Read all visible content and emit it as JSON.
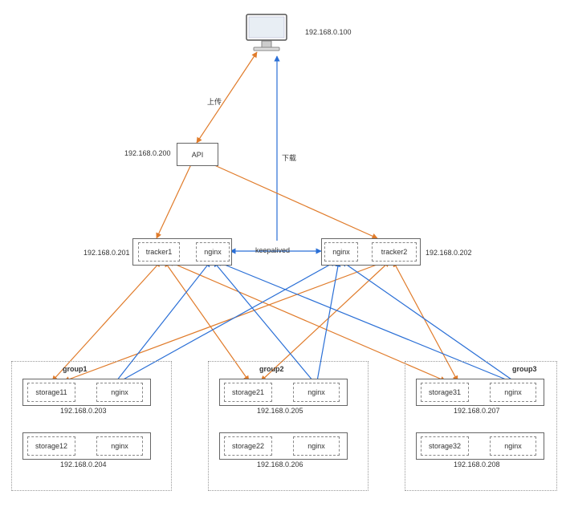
{
  "client": {
    "ip": "192.168.0.100"
  },
  "edges": {
    "upload": "上传",
    "download": "下载",
    "keepalived": "keepalived"
  },
  "api": {
    "label": "API",
    "ip": "192.168.0.200"
  },
  "tracker1": {
    "label": "tracker1",
    "nginx": "nginx",
    "ip": "192.168.0.201"
  },
  "tracker2": {
    "label": "tracker2",
    "nginx": "nginx",
    "ip": "192.168.0.202"
  },
  "group1": {
    "title": "group1",
    "a": {
      "storage": "storage11",
      "nginx": "nginx",
      "ip": "192.168.0.203"
    },
    "b": {
      "storage": "storage12",
      "nginx": "nginx",
      "ip": "192.168.0.204"
    }
  },
  "group2": {
    "title": "group2",
    "a": {
      "storage": "storage21",
      "nginx": "nginx",
      "ip": "192.168.0.205"
    },
    "b": {
      "storage": "storage22",
      "nginx": "nginx",
      "ip": "192.168.0.206"
    }
  },
  "group3": {
    "title": "group3",
    "a": {
      "storage": "storage31",
      "nginx": "nginx",
      "ip": "192.168.0.207"
    },
    "b": {
      "storage": "storage32",
      "nginx": "nginx",
      "ip": "192.168.0.208"
    }
  },
  "colors": {
    "orange": "#e07b2a",
    "blue": "#2a6fd6"
  }
}
